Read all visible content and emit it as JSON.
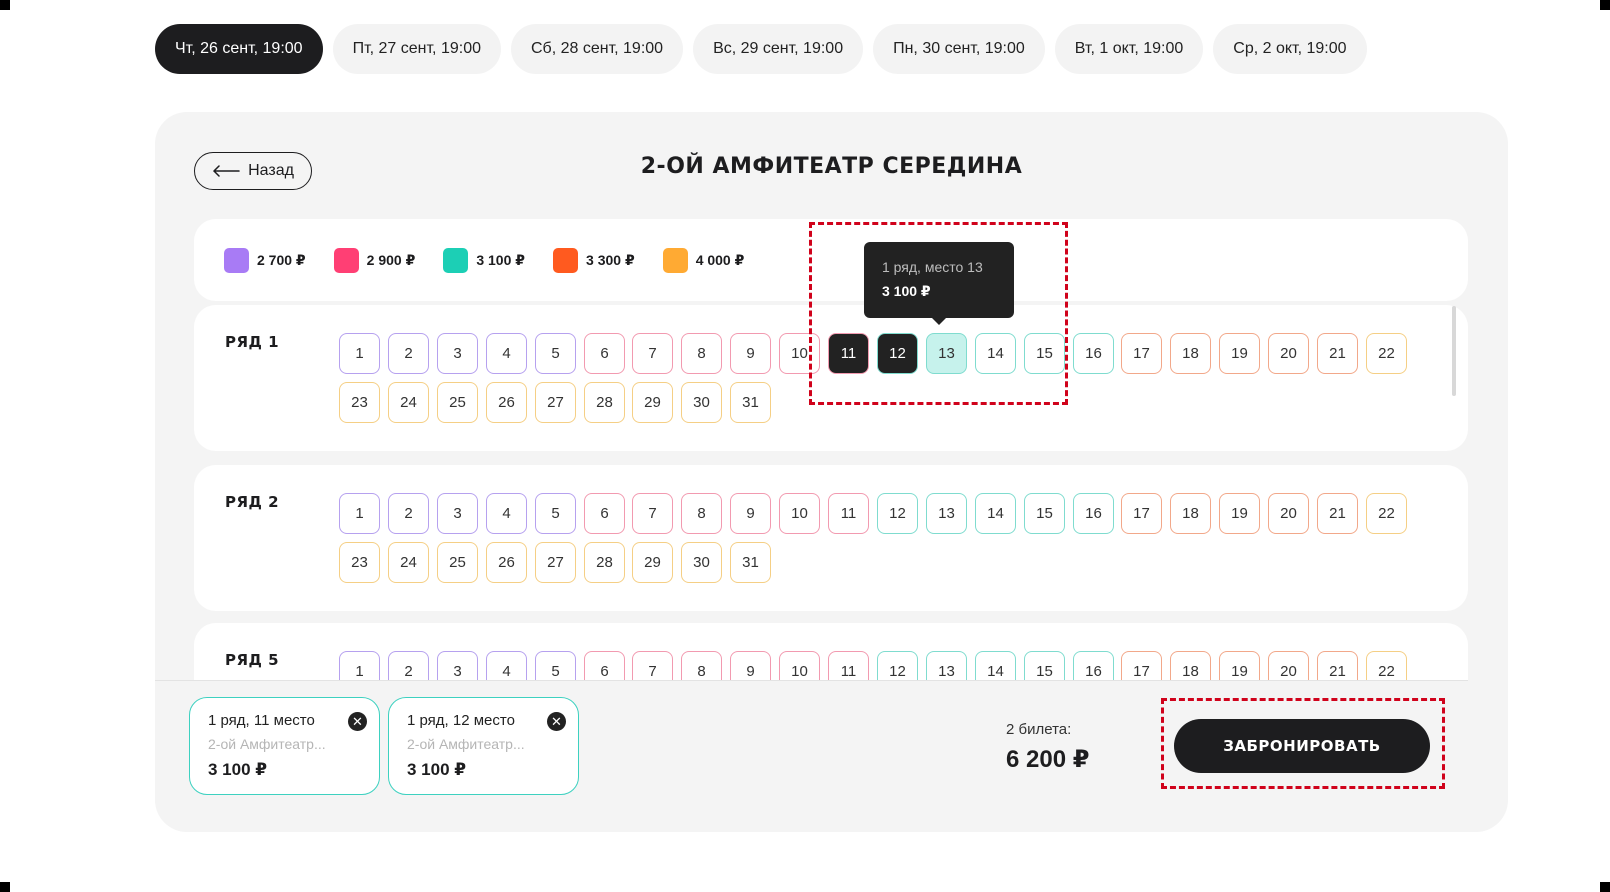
{
  "date_tabs": [
    {
      "label": "Чт, 26 сент, 19:00",
      "active": true
    },
    {
      "label": "Пт, 27 сент, 19:00",
      "active": false
    },
    {
      "label": "Сб, 28 сент, 19:00",
      "active": false
    },
    {
      "label": "Вс, 29 сент, 19:00",
      "active": false
    },
    {
      "label": "Пн, 30 сент, 19:00",
      "active": false
    },
    {
      "label": "Вт, 1 окт, 19:00",
      "active": false
    },
    {
      "label": "Ср, 2 окт, 19:00",
      "active": false
    }
  ],
  "back_label": "Назад",
  "section_title": "2-ОЙ АМФИТЕАТР СЕРЕДИНА",
  "legend": [
    {
      "price": "2 700 ₽",
      "color": "#a87bf5"
    },
    {
      "price": "2 900 ₽",
      "color": "#ff3f74"
    },
    {
      "price": "3 100 ₽",
      "color": "#1ccfb5"
    },
    {
      "price": "3 300 ₽",
      "color": "#ff5a1f"
    },
    {
      "price": "4 000 ₽",
      "color": "#ffaa33"
    }
  ],
  "seat_colors": {
    "purple": "#b6a1ef",
    "pink": "#f29ab0",
    "teal": "#7fdccf",
    "orange": "#f2a88a",
    "yellow": "#f5cf85"
  },
  "rows": [
    {
      "label": "РЯД 1",
      "seats": [
        "1",
        "2",
        "3",
        "4",
        "5",
        "6",
        "7",
        "8",
        "9",
        "10",
        "11",
        "12",
        "13",
        "14",
        "15",
        "16",
        "17",
        "18",
        "19",
        "20",
        "21",
        "22",
        "23",
        "24",
        "25",
        "26",
        "27",
        "28",
        "29",
        "30",
        "31"
      ],
      "selected": [
        "11",
        "12"
      ],
      "hovered": "13",
      "colors": [
        "purple",
        "purple",
        "purple",
        "purple",
        "purple",
        "pink",
        "pink",
        "pink",
        "pink",
        "pink",
        "pink",
        "teal",
        "teal",
        "teal",
        "teal",
        "teal",
        "orange",
        "orange",
        "orange",
        "orange",
        "orange",
        "yellow",
        "yellow",
        "yellow",
        "yellow",
        "yellow",
        "yellow",
        "yellow",
        "yellow",
        "yellow",
        "yellow"
      ]
    },
    {
      "label": "РЯД 2",
      "seats": [
        "1",
        "2",
        "3",
        "4",
        "5",
        "6",
        "7",
        "8",
        "9",
        "10",
        "11",
        "12",
        "13",
        "14",
        "15",
        "16",
        "17",
        "18",
        "19",
        "20",
        "21",
        "22",
        "23",
        "24",
        "25",
        "26",
        "27",
        "28",
        "29",
        "30",
        "31"
      ],
      "selected": [],
      "hovered": null,
      "colors": [
        "purple",
        "purple",
        "purple",
        "purple",
        "purple",
        "pink",
        "pink",
        "pink",
        "pink",
        "pink",
        "pink",
        "teal",
        "teal",
        "teal",
        "teal",
        "teal",
        "orange",
        "orange",
        "orange",
        "orange",
        "orange",
        "yellow",
        "yellow",
        "yellow",
        "yellow",
        "yellow",
        "yellow",
        "yellow",
        "yellow",
        "yellow",
        "yellow"
      ]
    },
    {
      "label": "РЯД 5",
      "seats": [
        "1",
        "2",
        "3",
        "4",
        "5",
        "6",
        "7",
        "8",
        "9",
        "10",
        "11",
        "12",
        "13",
        "14",
        "15",
        "16",
        "17",
        "18",
        "19",
        "20",
        "21",
        "22"
      ],
      "selected": [],
      "hovered": null,
      "colors": [
        "purple",
        "purple",
        "purple",
        "purple",
        "purple",
        "pink",
        "pink",
        "pink",
        "pink",
        "pink",
        "pink",
        "teal",
        "teal",
        "teal",
        "teal",
        "teal",
        "orange",
        "orange",
        "orange",
        "orange",
        "orange",
        "yellow"
      ]
    }
  ],
  "tooltip": {
    "line1": "1 ряд, место 13",
    "line2": "3 100 ₽"
  },
  "tickets": [
    {
      "title": "1 ряд, 11 место",
      "subtitle": "2-ой Амфитеатр...",
      "price": "3 100 ₽"
    },
    {
      "title": "1 ряд, 12 место",
      "subtitle": "2-ой Амфитеатр...",
      "price": "3 100 ₽"
    }
  ],
  "total_label": "2 билета:",
  "total_value": "6 200 ₽",
  "book_label": "ЗАБРОНИРОВАТЬ"
}
